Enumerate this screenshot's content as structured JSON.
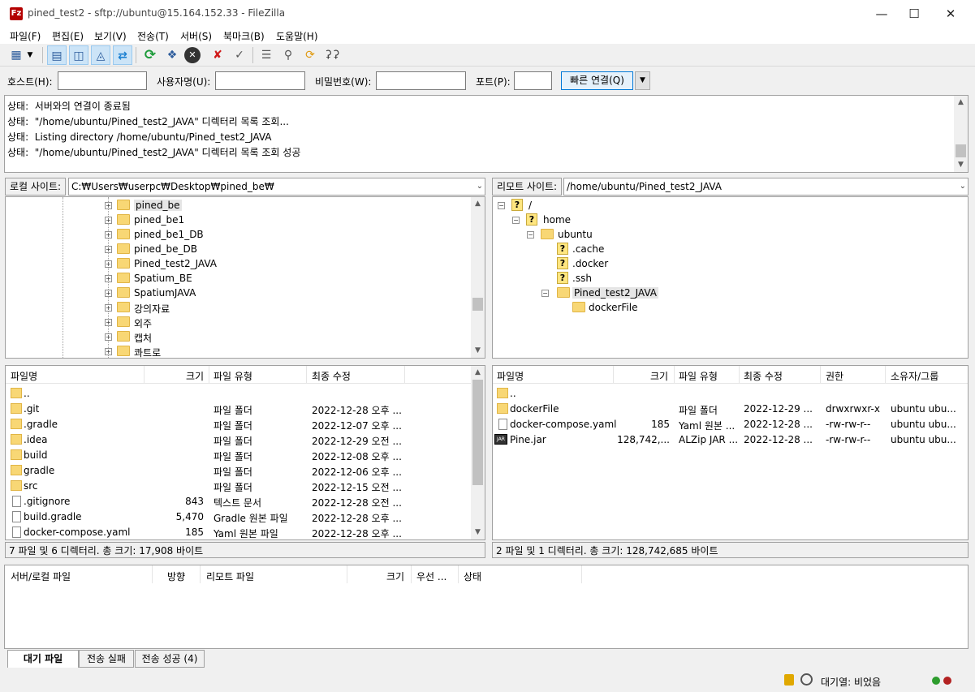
{
  "window": {
    "title": "pined_test2 - sftp://ubuntu@15.164.152.33 - FileZilla",
    "app_icon": "Fz"
  },
  "menu": [
    "파일(F)",
    "편집(E)",
    "보기(V)",
    "전송(T)",
    "서버(S)",
    "북마크(B)",
    "도움말(H)"
  ],
  "quickconnect": {
    "host_label": "호스트(H):",
    "user_label": "사용자명(U):",
    "pass_label": "비밀번호(W):",
    "port_label": "포트(P):",
    "button": "빠른 연결(Q)"
  },
  "log": [
    {
      "tag": "상태:",
      "text": "서버와의 연결이 종료됨"
    },
    {
      "tag": "상태:",
      "text": "\"/home/ubuntu/Pined_test2_JAVA\" 디렉터리 목록 조회..."
    },
    {
      "tag": "상태:",
      "text": "Listing directory /home/ubuntu/Pined_test2_JAVA"
    },
    {
      "tag": "상태:",
      "text": "\"/home/ubuntu/Pined_test2_JAVA\" 디렉터리 목록 조회 성공"
    }
  ],
  "local": {
    "label": "로컬 사이트:",
    "path": "C:₩Users₩userpc₩Desktop₩pined_be₩",
    "tree": [
      "pined_be",
      "pined_be1",
      "pined_be1_DB",
      "pined_be_DB",
      "Pined_test2_JAVA",
      "Spatium_BE",
      "SpatiumJAVA",
      "강의자료",
      "외주",
      "캡처",
      "콰트로"
    ],
    "headers": {
      "name": "파일명",
      "size": "크기",
      "type": "파일 유형",
      "modified": "최종 수정"
    },
    "files": [
      {
        "name": "..",
        "size": "",
        "type": "",
        "modified": "",
        "kind": "folder"
      },
      {
        "name": ".git",
        "size": "",
        "type": "파일 폴더",
        "modified": "2022-12-28 오후 ...",
        "kind": "folder"
      },
      {
        "name": ".gradle",
        "size": "",
        "type": "파일 폴더",
        "modified": "2022-12-07 오후 ...",
        "kind": "folder"
      },
      {
        "name": ".idea",
        "size": "",
        "type": "파일 폴더",
        "modified": "2022-12-29 오전 ...",
        "kind": "folder"
      },
      {
        "name": "build",
        "size": "",
        "type": "파일 폴더",
        "modified": "2022-12-08 오후 ...",
        "kind": "folder"
      },
      {
        "name": "gradle",
        "size": "",
        "type": "파일 폴더",
        "modified": "2022-12-06 오후 ...",
        "kind": "folder"
      },
      {
        "name": "src",
        "size": "",
        "type": "파일 폴더",
        "modified": "2022-12-15 오전 ...",
        "kind": "folder"
      },
      {
        "name": ".gitignore",
        "size": "843",
        "type": "텍스트 문서",
        "modified": "2022-12-28 오전 ...",
        "kind": "doc"
      },
      {
        "name": "build.gradle",
        "size": "5,470",
        "type": "Gradle 원본 파일",
        "modified": "2022-12-28 오후 ...",
        "kind": "doc"
      },
      {
        "name": "docker-compose.yaml",
        "size": "185",
        "type": "Yaml 원본 파일",
        "modified": "2022-12-28 오후 ...",
        "kind": "doc"
      }
    ],
    "status": "7 파일 및 6 디렉터리. 총 크기: 17,908 바이트"
  },
  "remote": {
    "label": "리모트 사이트:",
    "path": "/home/ubuntu/Pined_test2_JAVA",
    "tree": [
      {
        "name": "/",
        "icon": "question"
      },
      {
        "name": "home",
        "icon": "question"
      },
      {
        "name": "ubuntu",
        "icon": "folder"
      },
      {
        "name": ".cache",
        "icon": "question"
      },
      {
        "name": ".docker",
        "icon": "question"
      },
      {
        "name": ".ssh",
        "icon": "question"
      },
      {
        "name": "Pined_test2_JAVA",
        "icon": "folder"
      },
      {
        "name": "dockerFile",
        "icon": "folder"
      }
    ],
    "headers": {
      "name": "파일명",
      "size": "크기",
      "type": "파일 유형",
      "modified": "최종 수정",
      "perm": "권한",
      "owner": "소유자/그룹"
    },
    "files": [
      {
        "name": "..",
        "size": "",
        "type": "",
        "modified": "",
        "perm": "",
        "owner": "",
        "kind": "folder"
      },
      {
        "name": "dockerFile",
        "size": "",
        "type": "파일 폴더",
        "modified": "2022-12-29 ...",
        "perm": "drwxrwxr-x",
        "owner": "ubuntu ubu...",
        "kind": "folder"
      },
      {
        "name": "docker-compose.yaml",
        "size": "185",
        "type": "Yaml 원본 ...",
        "modified": "2022-12-28 ...",
        "perm": "-rw-rw-r--",
        "owner": "ubuntu ubu...",
        "kind": "doc"
      },
      {
        "name": "Pine.jar",
        "size": "128,742,...",
        "type": "ALZip JAR ...",
        "modified": "2022-12-28 ...",
        "perm": "-rw-rw-r--",
        "owner": "ubuntu ubu...",
        "kind": "jar"
      }
    ],
    "status": "2 파일 및 1 디렉터리. 총 크기: 128,742,685 바이트"
  },
  "queue": {
    "headers": [
      "서버/로컬 파일",
      "방향",
      "리모트 파일",
      "크기",
      "우선 ...",
      "상태"
    ],
    "tabs": [
      "대기 파일",
      "전송 실패",
      "전송 성공 (4)"
    ],
    "queue_status": "대기열: 비었음"
  }
}
